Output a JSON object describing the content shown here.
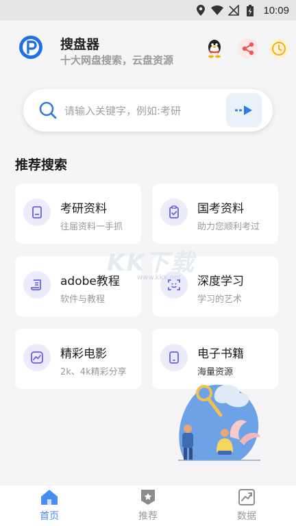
{
  "status_bar": {
    "time": "10:09"
  },
  "header": {
    "title": "搜盘器",
    "subtitle": "十大网盘搜索，云盘资源"
  },
  "search": {
    "placeholder": "请输入关键字，例如:考研"
  },
  "section_title": "推荐搜索",
  "cards": [
    {
      "title": "考研资料",
      "subtitle": "往届资料一手抓",
      "icon": "document-icon"
    },
    {
      "title": "国考资料",
      "subtitle": "助力您顺利考过",
      "icon": "clipboard-check-icon"
    },
    {
      "title": "adobe教程",
      "subtitle": "软件与教程",
      "icon": "scroll-icon"
    },
    {
      "title": "深度学习",
      "subtitle": "学习的艺术",
      "icon": "scan-icon"
    },
    {
      "title": "精彩电影",
      "subtitle": "2k、4k精彩分享",
      "icon": "chart-line-icon"
    },
    {
      "title": "电子书籍",
      "subtitle": "海量资源",
      "icon": "tablet-icon"
    }
  ],
  "watermark": {
    "text": "KK下载",
    "url": "www.kkx.net"
  },
  "nav": [
    {
      "label": "首页",
      "active": true
    },
    {
      "label": "推荐",
      "active": false
    },
    {
      "label": "数据",
      "active": false
    }
  ],
  "colors": {
    "accent": "#4a8df0",
    "icon_bg": "#ecebfb",
    "icon_stroke": "#6c5ce7",
    "background": "#f5f5f7"
  }
}
